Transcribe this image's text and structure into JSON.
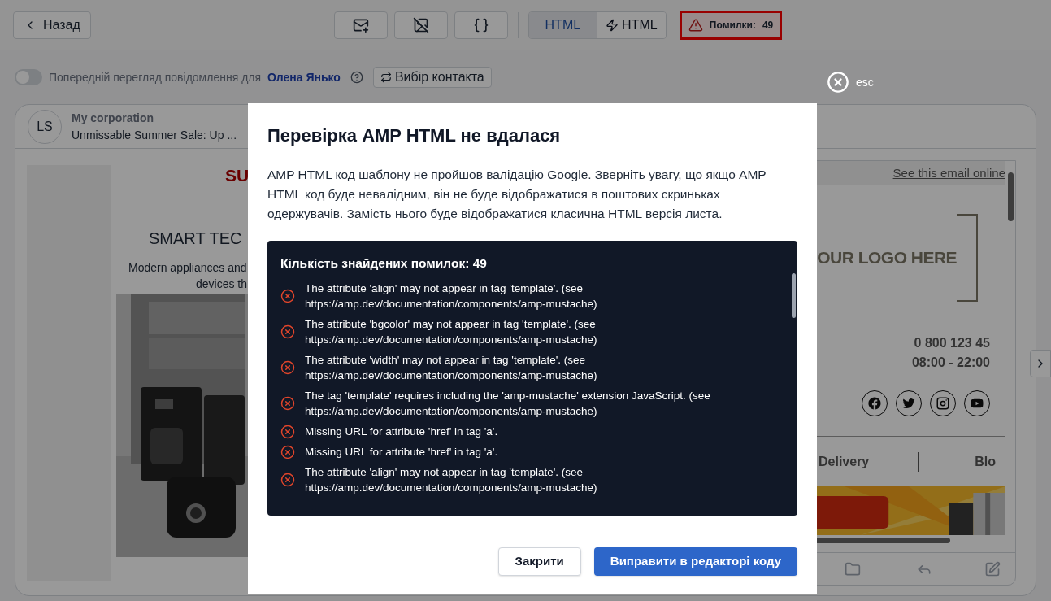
{
  "toolbar": {
    "back_button": "Назад",
    "format_toggle": [
      {
        "label": "HTML",
        "selected": true,
        "kind": "plain"
      },
      {
        "label": "HTML",
        "selected": false,
        "kind": "amp"
      }
    ],
    "errors_badge": {
      "label": "Помилки:",
      "count": "49"
    }
  },
  "preview_bar": {
    "toggle_on": false,
    "label": "Попередній перегляд повідомлення для",
    "contact": "Олена Янько",
    "contact_button": "Вибір контакта"
  },
  "email": {
    "avatar": "LS",
    "sender": "My corporation",
    "subject": "Unmissable Summer Sale: Up ...",
    "content": {
      "headline": "SU",
      "title": "SMART TEC",
      "lines": [
        "Modern appliances and",
        "devices th"
      ]
    },
    "mobile_preview": {
      "online_link": "See this email online",
      "logo": "OUR LOGO HERE",
      "phone": "0 800 123 45",
      "hours": "08:00 - 22:00",
      "nav": [
        "Delivery",
        "Blo"
      ]
    }
  },
  "close_hint": "esc",
  "modal": {
    "title": "Перевірка AMP HTML не вдалася",
    "description": "AMP HTML код шаблону не пройшов валідацію Google. Зверніть увагу, що якщо AMP HTML код буде невалідним, він не буде відображатися в поштових скриньках одержувачів. Замість нього буде відображатися класична HTML версія листа.",
    "errors_heading": "Кількість знайдених помилок: 49",
    "errors": [
      "The attribute 'align' may not appear in tag 'template'. (see https://amp.dev/documentation/components/amp-mustache)",
      "The attribute 'bgcolor' may not appear in tag 'template'. (see https://amp.dev/documentation/components/amp-mustache)",
      "The attribute 'width' may not appear in tag 'template'. (see https://amp.dev/documentation/components/amp-mustache)",
      "The tag 'template' requires including the 'amp-mustache' extension JavaScript. (see https://amp.dev/documentation/components/amp-mustache)",
      "Missing URL for attribute 'href' in tag 'a'.",
      "Missing URL for attribute 'href' in tag 'a'.",
      "The attribute 'align' may not appear in tag 'template'. (see https://amp.dev/documentation/components/amp-mustache)"
    ],
    "buttons": [
      {
        "label": "Закрити",
        "kind": "secondary"
      },
      {
        "label": "Виправити в редакторі коду",
        "kind": "primary"
      }
    ]
  }
}
